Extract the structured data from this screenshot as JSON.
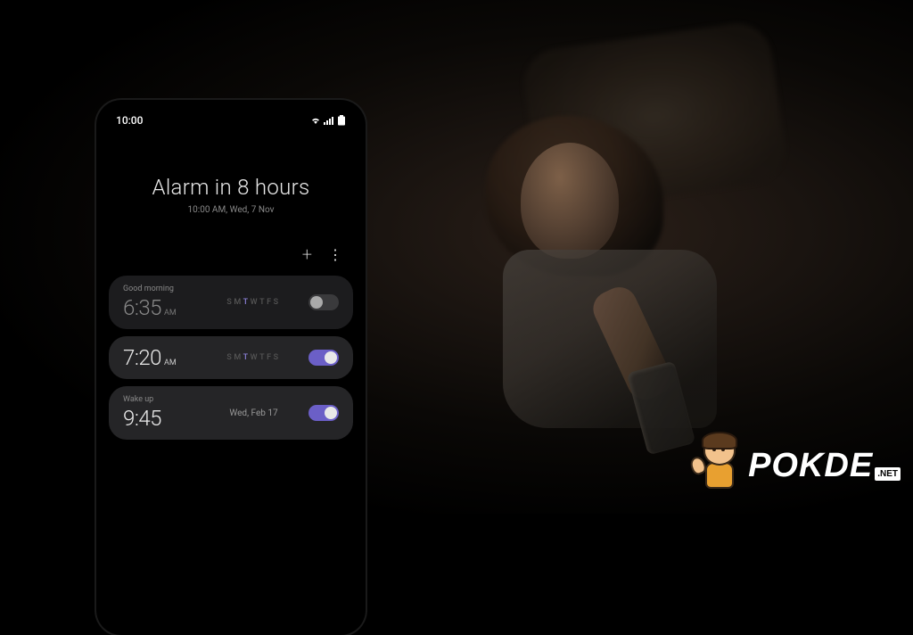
{
  "status_bar": {
    "time": "10:00",
    "icons": [
      "wifi-icon",
      "signal-icon",
      "battery-icon"
    ]
  },
  "header": {
    "title": "Alarm in 8 hours",
    "subtitle": "10:00 AM, Wed, 7 Nov"
  },
  "actions": {
    "add_label": "+",
    "more_label": "⋮"
  },
  "alarms": [
    {
      "label": "Good morning",
      "time": "6:35",
      "ampm": "AM",
      "enabled": false,
      "repeat_type": "days",
      "days": [
        {
          "letter": "S",
          "active": false
        },
        {
          "letter": "M",
          "active": false
        },
        {
          "letter": "T",
          "active": true
        },
        {
          "letter": "W",
          "active": false
        },
        {
          "letter": "T",
          "active": false
        },
        {
          "letter": "F",
          "active": false
        },
        {
          "letter": "S",
          "active": false
        }
      ]
    },
    {
      "label": "",
      "time": "7:20",
      "ampm": "AM",
      "enabled": true,
      "repeat_type": "days",
      "days": [
        {
          "letter": "S",
          "active": false
        },
        {
          "letter": "M",
          "active": false
        },
        {
          "letter": "T",
          "active": true
        },
        {
          "letter": "W",
          "active": false
        },
        {
          "letter": "T",
          "active": false
        },
        {
          "letter": "F",
          "active": false
        },
        {
          "letter": "S",
          "active": false
        }
      ]
    },
    {
      "label": "Wake up",
      "time": "9:45",
      "ampm": "",
      "enabled": true,
      "repeat_type": "date",
      "date": "Wed, Feb 17"
    }
  ],
  "watermark": {
    "brand": "POKDE",
    "suffix": ".NET"
  },
  "colors": {
    "accent": "#6b5fc7",
    "card_bg": "#1c1c1e",
    "text_primary": "#e8e8e8",
    "text_secondary": "#888"
  }
}
